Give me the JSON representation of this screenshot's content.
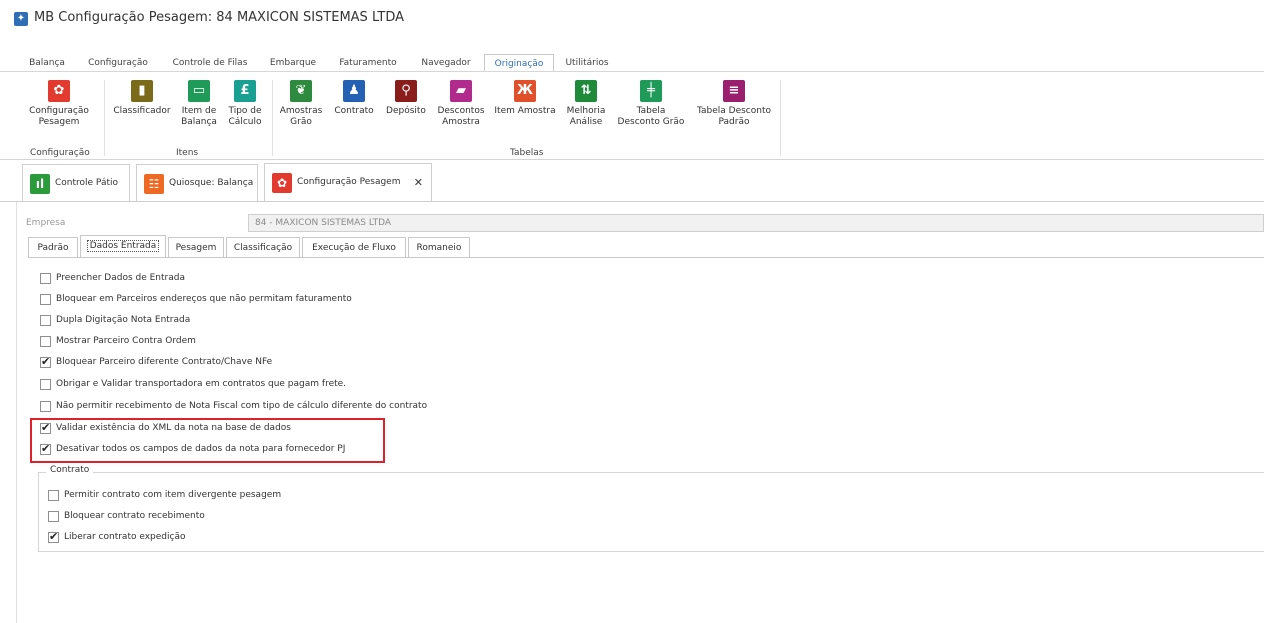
{
  "window": {
    "title": "MB Configuração Pesagem: 84 MAXICON SISTEMAS LTDA",
    "icon": "app-icon"
  },
  "menu": {
    "tabs": [
      {
        "label": "Balança",
        "active": false
      },
      {
        "label": "Configuração",
        "active": false
      },
      {
        "label": "Controle de Filas",
        "active": false
      },
      {
        "label": "Embarque",
        "active": false
      },
      {
        "label": "Faturamento",
        "active": false
      },
      {
        "label": "Navegador",
        "active": false
      },
      {
        "label": "Originação",
        "active": true
      },
      {
        "label": "Utilitários",
        "active": false
      }
    ]
  },
  "ribbon": {
    "groups": [
      {
        "label": "Configuração"
      },
      {
        "label": "Itens"
      },
      {
        "label": "Tabelas"
      }
    ],
    "buttons": [
      {
        "label": "Configuração\nPesagem",
        "icon": "gear-icon",
        "color": "#e23a2f"
      },
      {
        "label": "Classificador",
        "icon": "bookmark-icon",
        "color": "#7a6a1a"
      },
      {
        "label": "Item de\nBalança",
        "icon": "box-icon",
        "color": "#1f9a58"
      },
      {
        "label": "Tipo de\nCálculo",
        "icon": "currency-icon",
        "color": "#1aa092"
      },
      {
        "label": "Amostras\nGrão",
        "icon": "sprout-icon",
        "color": "#2e8a3e"
      },
      {
        "label": "Contrato",
        "icon": "contract-icon",
        "color": "#2460b3"
      },
      {
        "label": "Depósito",
        "icon": "location-pin-icon",
        "color": "#8a1c1c"
      },
      {
        "label": "Descontos\nAmostra",
        "icon": "discount-icon",
        "color": "#b02b8c"
      },
      {
        "label": "Item Amostra",
        "icon": "item-sample-icon",
        "color": "#e0502a"
      },
      {
        "label": "Melhoria\nAnálise",
        "icon": "improvement-icon",
        "color": "#1f8a3a"
      },
      {
        "label": "Tabela\nDesconto Grão",
        "icon": "grain-table-icon",
        "color": "#1f9a58"
      },
      {
        "label": "Tabela Desconto\nPadrão",
        "icon": "list-icon",
        "color": "#9a1f6e"
      }
    ]
  },
  "doc_tabs": [
    {
      "label": "Controle Pátio",
      "icon": "chart-icon",
      "color": "#2a9a3a",
      "active": false
    },
    {
      "label": "Quiosque: Balança",
      "icon": "grid-icon",
      "color": "#ee6a24",
      "active": false
    },
    {
      "label": "Configuração Pesagem",
      "icon": "gear-icon",
      "color": "#e23a2f",
      "active": true,
      "close": "✕"
    }
  ],
  "form": {
    "empresa_label": "Empresa",
    "empresa_value": "84 - MAXICON SISTEMAS LTDA"
  },
  "inner_tabs": [
    {
      "label": "Padrão",
      "active": false
    },
    {
      "label": "Dados Entrada",
      "active": true
    },
    {
      "label": "Pesagem",
      "active": false
    },
    {
      "label": "Classificação",
      "active": false
    },
    {
      "label": "Execução de Fluxo",
      "active": false
    },
    {
      "label": "Romaneio",
      "active": false
    }
  ],
  "checkboxes": [
    {
      "label": "Preencher Dados de Entrada",
      "checked": false
    },
    {
      "label": "Bloquear em Parceiros endereços que não permitam faturamento",
      "checked": false
    },
    {
      "label": "Dupla Digitação Nota Entrada",
      "checked": false
    },
    {
      "label": "Mostrar Parceiro Contra Ordem",
      "checked": false
    },
    {
      "label": "Bloquear Parceiro diferente Contrato/Chave NFe",
      "checked": true
    },
    {
      "label": "Obrigar e Validar transportadora em contratos que pagam frete.",
      "checked": false
    },
    {
      "label": "Não permitir recebimento de Nota Fiscal com tipo de cálculo diferente do contrato",
      "checked": false
    },
    {
      "label": "Validar existência do XML da nota na base de dados",
      "checked": true
    },
    {
      "label": "Desativar todos os campos de dados da nota para fornecedor PJ",
      "checked": true
    }
  ],
  "contrato": {
    "legend": "Contrato",
    "checkboxes": [
      {
        "label": "Permitir contrato com item divergente pesagem",
        "checked": false
      },
      {
        "label": "Bloquear contrato recebimento",
        "checked": false
      },
      {
        "label": "Liberar contrato expedição",
        "checked": true
      }
    ]
  },
  "highlight_color": "#e0202a"
}
